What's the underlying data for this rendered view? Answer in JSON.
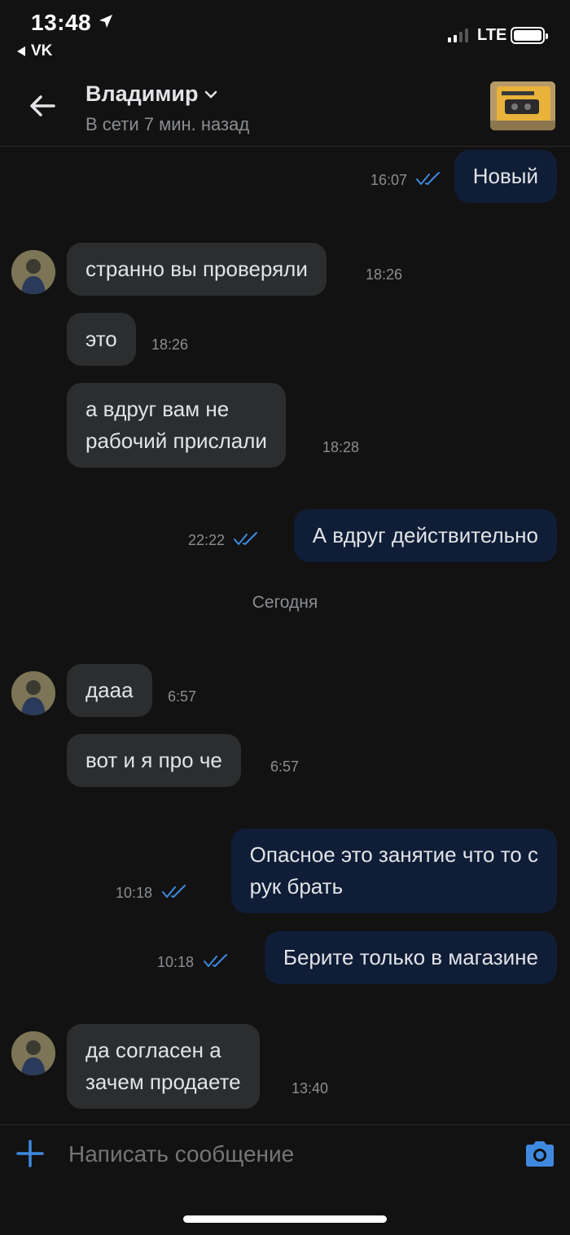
{
  "status_bar": {
    "time": "13:48",
    "back_app": "VK",
    "network": "LTE"
  },
  "header": {
    "name": "Владимир",
    "status": "В сети 7 мин. назад"
  },
  "messages": [
    {
      "dir": "out",
      "text": "Новый",
      "time": "16:07"
    },
    {
      "dir": "in",
      "text": "странно вы проверяли",
      "time": "18:26"
    },
    {
      "dir": "in",
      "text": "это",
      "time": "18:26"
    },
    {
      "dir": "in",
      "text": "а вдруг вам не\nрабочий прислали",
      "time": "18:28"
    },
    {
      "dir": "out",
      "text": "А вдруг действительно",
      "time": "22:22"
    },
    {
      "dir": "in",
      "text": "дааа",
      "time": "6:57"
    },
    {
      "dir": "in",
      "text": "вот и я про че",
      "time": "6:57"
    },
    {
      "dir": "out",
      "text": "Опасное это занятие что то с\nрук брать",
      "time": "10:18"
    },
    {
      "dir": "out",
      "text": "Берите только в магазине",
      "time": "10:18"
    },
    {
      "dir": "in",
      "text": "да согласен а\nзачем продаете",
      "time": "13:40"
    }
  ],
  "date_separator": "Сегодня",
  "composer": {
    "placeholder": "Написать сообщение"
  },
  "colors": {
    "accent": "#3f8ae0",
    "incoming_bubble": "#2c2d2e",
    "outgoing_bubble": "#0f1d37"
  },
  "icons": [
    "back-arrow-icon",
    "chevron-down-icon",
    "read-checks-icon",
    "plus-icon",
    "camera-icon",
    "location-arrow-icon"
  ]
}
